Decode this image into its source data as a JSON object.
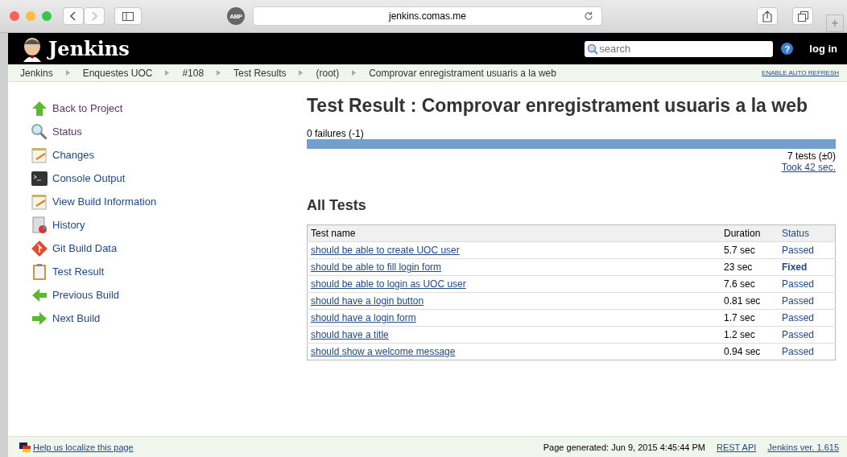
{
  "browser": {
    "address": "jenkins.comas.me",
    "adblock_badge": "ABP",
    "new_tab": "+"
  },
  "header": {
    "logo": "Jenkins",
    "search": {
      "placeholder": "search"
    },
    "help": "?",
    "login": "log in"
  },
  "breadcrumbs": [
    "Jenkins",
    "Enquestes UOC",
    "#108",
    "Test Results",
    "(root)",
    "Comprovar enregistrament usuaris a la web"
  ],
  "auto_refresh": "ENABLE AUTO REFRESH",
  "sidebar": {
    "items": [
      {
        "label": "Back to Project",
        "kind": "up",
        "visited": true
      },
      {
        "label": "Status",
        "kind": "search",
        "visited": true
      },
      {
        "label": "Changes",
        "kind": "notepad",
        "visited": false
      },
      {
        "label": "Console Output",
        "kind": "terminal",
        "visited": false
      },
      {
        "label": "View Build Information",
        "kind": "notepad",
        "visited": false
      },
      {
        "label": "History",
        "kind": "history",
        "visited": false
      },
      {
        "label": "Git Build Data",
        "kind": "git",
        "visited": false
      },
      {
        "label": "Test Result",
        "kind": "clipboard",
        "visited": false
      },
      {
        "label": "Previous Build",
        "kind": "left",
        "visited": false
      },
      {
        "label": "Next Build",
        "kind": "right",
        "visited": false
      }
    ]
  },
  "title": "Test Result : Comprovar enregistrament usuaris a la web",
  "summary": {
    "failures": "0 failures (-1)",
    "level": 1,
    "tests": "7 tests (±0)",
    "took": "Took 42 sec."
  },
  "all_tests": {
    "heading": "All Tests",
    "columns": [
      "Test name",
      "Duration",
      "Status"
    ],
    "rows": [
      {
        "name": "should be able to create UOC user",
        "duration": "5.7 sec",
        "status": "Passed",
        "kind": "passed"
      },
      {
        "name": "should be able to fill login form",
        "duration": "23 sec",
        "status": "Fixed",
        "kind": "fixed"
      },
      {
        "name": "should be able to login as UOC user",
        "duration": "7.6 sec",
        "status": "Passed",
        "kind": "passed"
      },
      {
        "name": "should have a login button",
        "duration": "0.81 sec",
        "status": "Passed",
        "kind": "passed"
      },
      {
        "name": "should have a login form",
        "duration": "1.7 sec",
        "status": "Passed",
        "kind": "passed"
      },
      {
        "name": "should have a title",
        "duration": "1.2 sec",
        "status": "Passed",
        "kind": "passed"
      },
      {
        "name": "should show a welcome message",
        "duration": "0.94 sec",
        "status": "Passed",
        "kind": "passed"
      }
    ]
  },
  "footer": {
    "localize": "Help us localize this page",
    "generated": "Page generated: Jun 9, 2015 4:45:44 PM",
    "rest_api": "REST API",
    "version": "Jenkins ver. 1.615"
  }
}
